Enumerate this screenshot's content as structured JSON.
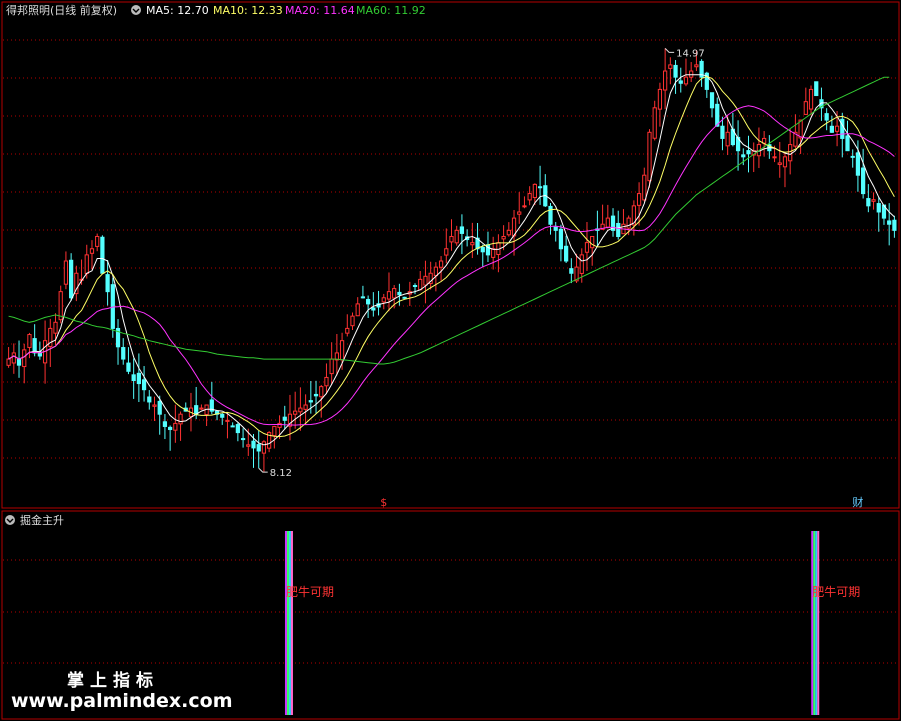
{
  "chart_data": [
    {
      "type": "candlestick",
      "title": "得邦照明(日线 前复权)",
      "ylim": [
        7.6,
        15.4
      ],
      "legend": [
        {
          "name": "MA5",
          "text": "MA5: 12.70",
          "color": "#ffffff"
        },
        {
          "name": "MA10",
          "text": "MA10: 12.33",
          "color": "#ffff66"
        },
        {
          "name": "MA20",
          "text": "MA20: 11.64",
          "color": "#ff33ff"
        },
        {
          "name": "MA60",
          "text": "MA60: 11.92",
          "color": "#33cc33"
        }
      ],
      "annotations": [
        {
          "text": "14.97",
          "value": 14.97,
          "index": 126
        },
        {
          "text": "8.12",
          "value": 8.12,
          "index": 48
        }
      ],
      "markers": [
        {
          "text": "$",
          "index": 72,
          "color": "#ff3333"
        },
        {
          "text": "财",
          "index": 163,
          "color": "#66ccff"
        }
      ],
      "closes": [
        9.9,
        10.0,
        9.8,
        10.05,
        10.3,
        10.0,
        9.95,
        10.2,
        10.4,
        10.5,
        11.0,
        11.5,
        10.9,
        11.3,
        11.2,
        11.6,
        11.7,
        11.9,
        11.3,
        11.0,
        10.4,
        10.1,
        9.9,
        9.7,
        9.55,
        9.5,
        9.4,
        9.2,
        9.15,
        9.0,
        8.8,
        8.75,
        8.85,
        9.0,
        9.05,
        9.1,
        9.0,
        9.1,
        9.15,
        9.05,
        9.0,
        8.95,
        8.9,
        8.8,
        8.7,
        8.6,
        8.5,
        8.45,
        8.4,
        8.55,
        8.7,
        8.8,
        8.85,
        8.9,
        9.0,
        9.05,
        9.1,
        9.15,
        9.2,
        9.3,
        9.45,
        9.6,
        9.9,
        10.0,
        10.2,
        10.4,
        10.6,
        10.8,
        10.9,
        10.8,
        10.7,
        10.75,
        10.9,
        11.0,
        11.05,
        10.95,
        10.9,
        11.0,
        11.1,
        11.2,
        11.25,
        11.3,
        11.4,
        11.5,
        11.7,
        11.9,
        12.0,
        11.95,
        11.85,
        11.8,
        11.7,
        11.65,
        11.6,
        11.7,
        11.8,
        11.9,
        12.0,
        12.2,
        12.3,
        12.4,
        12.6,
        12.75,
        12.7,
        12.4,
        12.1,
        12.0,
        11.7,
        11.5,
        11.3,
        11.4,
        11.6,
        11.8,
        11.9,
        12.0,
        12.1,
        12.2,
        12.0,
        11.9,
        12.1,
        12.2,
        12.4,
        12.6,
        12.9,
        13.6,
        14.0,
        14.3,
        14.6,
        14.7,
        14.5,
        14.4,
        14.5,
        14.6,
        14.7,
        14.5,
        14.3,
        14.0,
        13.7,
        13.5,
        13.6,
        13.4,
        13.3,
        13.2,
        13.25,
        13.3,
        13.4,
        13.5,
        13.3,
        13.2,
        13.1,
        13.2,
        13.4,
        13.6,
        13.8,
        14.1,
        14.3,
        14.2,
        14.0,
        13.8,
        13.6,
        13.7,
        13.5,
        13.3,
        13.2,
        12.9,
        12.6,
        12.4,
        12.5,
        12.3,
        12.2,
        12.1,
        12.0
      ],
      "ma60": [
        10.6,
        10.58,
        10.55,
        10.52,
        10.5,
        10.52,
        10.55,
        10.58,
        10.6,
        10.62,
        10.6,
        10.58,
        10.55,
        10.52,
        10.5,
        10.48,
        10.45,
        10.43,
        10.42,
        10.4,
        10.37,
        10.35,
        10.32,
        10.3,
        10.28,
        10.25,
        10.23,
        10.2,
        10.18,
        10.16,
        10.14,
        10.12,
        10.1,
        10.08,
        10.06,
        10.05,
        10.04,
        10.03,
        10.02,
        10.0,
        9.98,
        9.97,
        9.96,
        9.95,
        9.94,
        9.93,
        9.92,
        9.92,
        9.91,
        9.9,
        9.9,
        9.9,
        9.9,
        9.9,
        9.9,
        9.9,
        9.9,
        9.9,
        9.9,
        9.9,
        9.9,
        9.9,
        9.9,
        9.9,
        9.89,
        9.88,
        9.87,
        9.86,
        9.85,
        9.84,
        9.83,
        9.82,
        9.82,
        9.83,
        9.85,
        9.88,
        9.91,
        9.94,
        9.97,
        10.0,
        10.04,
        10.08,
        10.12,
        10.16,
        10.2,
        10.24,
        10.28,
        10.32,
        10.36,
        10.4,
        10.44,
        10.48,
        10.52,
        10.56,
        10.6,
        10.64,
        10.68,
        10.72,
        10.76,
        10.8,
        10.84,
        10.88,
        10.92,
        10.96,
        11.0,
        11.04,
        11.08,
        11.12,
        11.16,
        11.2,
        11.24,
        11.28,
        11.32,
        11.36,
        11.4,
        11.44,
        11.48,
        11.52,
        11.56,
        11.6,
        11.64,
        11.68,
        11.72,
        11.78,
        11.86,
        11.96,
        12.06,
        12.16,
        12.26,
        12.34,
        12.42,
        12.5,
        12.58,
        12.64,
        12.7,
        12.76,
        12.82,
        12.88,
        12.94,
        13.0,
        13.06,
        13.12,
        13.18,
        13.24,
        13.3,
        13.36,
        13.42,
        13.48,
        13.54,
        13.6,
        13.66,
        13.72,
        13.78,
        13.84,
        13.9,
        13.96,
        14.02,
        14.06,
        14.1,
        14.14,
        14.18,
        14.22,
        14.26,
        14.3,
        14.34,
        14.38,
        14.42,
        14.46,
        14.5,
        14.5
      ]
    },
    {
      "type": "signal",
      "title": "掘金主升",
      "signals": [
        {
          "index": 54,
          "text": "肥牛可期"
        },
        {
          "index": 155,
          "text": "肥牛可期"
        }
      ]
    }
  ],
  "watermark": {
    "title": "掌上指标",
    "url": "www.palmindex.com"
  },
  "colors": {
    "up": "#ff3232",
    "down": "#54ffff",
    "grid": "#b40000",
    "border": "#b40000",
    "legend_arrow": "#bbbbbb"
  }
}
